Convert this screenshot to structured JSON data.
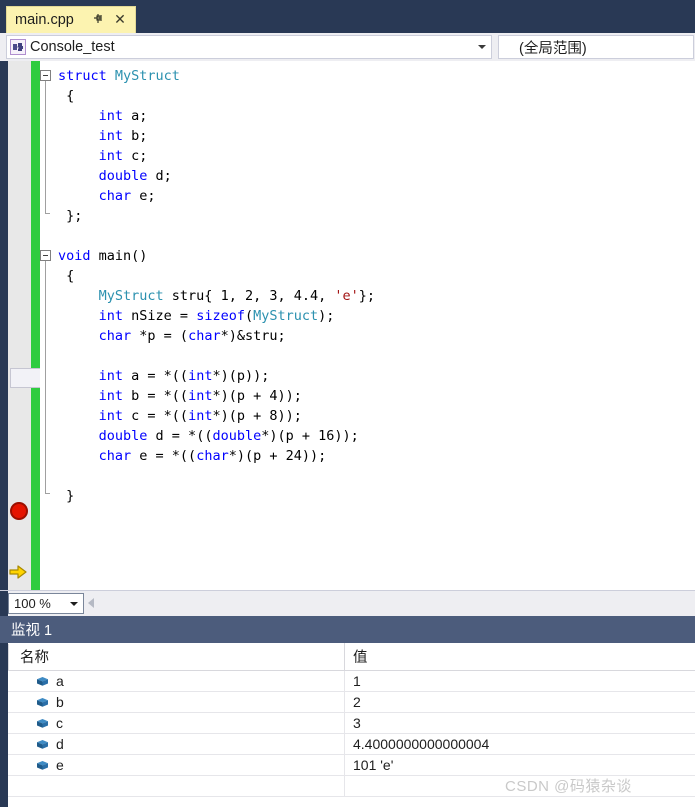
{
  "window": {
    "tab": {
      "label": "main.cpp",
      "pin_icon": "pin-icon",
      "close_icon": "close-icon"
    }
  },
  "navbar": {
    "project_icon": "project-scope-icon",
    "project": "Console_test",
    "scope": "(全局范围)"
  },
  "editor": {
    "zoom_level": "100 %",
    "breakpoint_icon": "breakpoint-icon",
    "execution_arrow_icon": "execution-pointer-icon",
    "current_line_index": 12,
    "syntax_colors": {
      "keyword": "#0000FF",
      "type": "#2B91AF",
      "string": "#A31515",
      "plain": "#000000",
      "change_bar": "#2ECC40"
    },
    "lines": [
      {
        "n": 1,
        "fold": true,
        "tokens": [
          {
            "t": "struct ",
            "c": "kw"
          },
          {
            "t": "MyStruct",
            "c": "typ"
          }
        ]
      },
      {
        "n": 2,
        "tokens": [
          {
            "t": " {",
            "c": "pl"
          }
        ]
      },
      {
        "n": 3,
        "tokens": [
          {
            "t": "     ",
            "c": "pl"
          },
          {
            "t": "int",
            "c": "kw"
          },
          {
            "t": " a;",
            "c": "pl"
          }
        ]
      },
      {
        "n": 4,
        "tokens": [
          {
            "t": "     ",
            "c": "pl"
          },
          {
            "t": "int",
            "c": "kw"
          },
          {
            "t": " b;",
            "c": "pl"
          }
        ]
      },
      {
        "n": 5,
        "tokens": [
          {
            "t": "     ",
            "c": "pl"
          },
          {
            "t": "int",
            "c": "kw"
          },
          {
            "t": " c;",
            "c": "pl"
          }
        ]
      },
      {
        "n": 6,
        "tokens": [
          {
            "t": "     ",
            "c": "pl"
          },
          {
            "t": "double",
            "c": "kw"
          },
          {
            "t": " d;",
            "c": "pl"
          }
        ]
      },
      {
        "n": 7,
        "tokens": [
          {
            "t": "     ",
            "c": "pl"
          },
          {
            "t": "char",
            "c": "kw"
          },
          {
            "t": " e;",
            "c": "pl"
          }
        ]
      },
      {
        "n": 8,
        "tokens": [
          {
            "t": " };",
            "c": "pl"
          }
        ]
      },
      {
        "n": 9,
        "tokens": []
      },
      {
        "n": 10,
        "fold": true,
        "tokens": [
          {
            "t": "void",
            "c": "kw"
          },
          {
            "t": " main()",
            "c": "pl"
          }
        ]
      },
      {
        "n": 11,
        "tokens": [
          {
            "t": " {",
            "c": "pl"
          }
        ]
      },
      {
        "n": 12,
        "tokens": [
          {
            "t": "     ",
            "c": "pl"
          },
          {
            "t": "MyStruct",
            "c": "typ"
          },
          {
            "t": " stru{ 1, 2, 3, 4.4, ",
            "c": "pl"
          },
          {
            "t": "'e'",
            "c": "str"
          },
          {
            "t": "};",
            "c": "pl"
          }
        ]
      },
      {
        "n": 13,
        "tokens": [
          {
            "t": "     ",
            "c": "pl"
          },
          {
            "t": "int",
            "c": "kw"
          },
          {
            "t": " nSize = ",
            "c": "pl"
          },
          {
            "t": "sizeof",
            "c": "kw"
          },
          {
            "t": "(",
            "c": "pl"
          },
          {
            "t": "MyStruct",
            "c": "typ"
          },
          {
            "t": ");",
            "c": "pl"
          }
        ]
      },
      {
        "n": 14,
        "tokens": [
          {
            "t": "     ",
            "c": "pl"
          },
          {
            "t": "char",
            "c": "kw"
          },
          {
            "t": " *p = (",
            "c": "pl"
          },
          {
            "t": "char",
            "c": "kw"
          },
          {
            "t": "*)&stru;",
            "c": "pl"
          }
        ]
      },
      {
        "n": 15,
        "tokens": []
      },
      {
        "n": 16,
        "tokens": [
          {
            "t": "     ",
            "c": "pl"
          },
          {
            "t": "int",
            "c": "kw"
          },
          {
            "t": " a = *((",
            "c": "pl"
          },
          {
            "t": "int",
            "c": "kw"
          },
          {
            "t": "*)(p));",
            "c": "pl"
          }
        ]
      },
      {
        "n": 17,
        "tokens": [
          {
            "t": "     ",
            "c": "pl"
          },
          {
            "t": "int",
            "c": "kw"
          },
          {
            "t": " b = *((",
            "c": "pl"
          },
          {
            "t": "int",
            "c": "kw"
          },
          {
            "t": "*)(p + 4));",
            "c": "pl"
          }
        ]
      },
      {
        "n": 18,
        "tokens": [
          {
            "t": "     ",
            "c": "pl"
          },
          {
            "t": "int",
            "c": "kw"
          },
          {
            "t": " c = *((",
            "c": "pl"
          },
          {
            "t": "int",
            "c": "kw"
          },
          {
            "t": "*)(p + 8));",
            "c": "pl"
          }
        ]
      },
      {
        "n": 19,
        "tokens": [
          {
            "t": "     ",
            "c": "pl"
          },
          {
            "t": "double",
            "c": "kw"
          },
          {
            "t": " d = *((",
            "c": "pl"
          },
          {
            "t": "double",
            "c": "kw"
          },
          {
            "t": "*)(p + 16));",
            "c": "pl"
          }
        ]
      },
      {
        "n": 20,
        "tokens": [
          {
            "t": "     ",
            "c": "pl"
          },
          {
            "t": "char",
            "c": "kw"
          },
          {
            "t": " e = *((",
            "c": "pl"
          },
          {
            "t": "char",
            "c": "kw"
          },
          {
            "t": "*)(p + 24));",
            "c": "pl"
          }
        ]
      },
      {
        "n": 21,
        "tokens": []
      },
      {
        "n": 22,
        "tokens": [
          {
            "t": " }",
            "c": "pl"
          }
        ]
      }
    ]
  },
  "watch": {
    "title": "监视 1",
    "columns": [
      "名称",
      "值"
    ],
    "rows": [
      {
        "icon": "variable-icon",
        "name": "a",
        "value": "1"
      },
      {
        "icon": "variable-icon",
        "name": "b",
        "value": "2"
      },
      {
        "icon": "variable-icon",
        "name": "c",
        "value": "3"
      },
      {
        "icon": "variable-icon",
        "name": "d",
        "value": "4.4000000000000004"
      },
      {
        "icon": "variable-icon",
        "name": "e",
        "value": "101 'e'"
      }
    ]
  },
  "watermark": "CSDN @码猿杂谈"
}
